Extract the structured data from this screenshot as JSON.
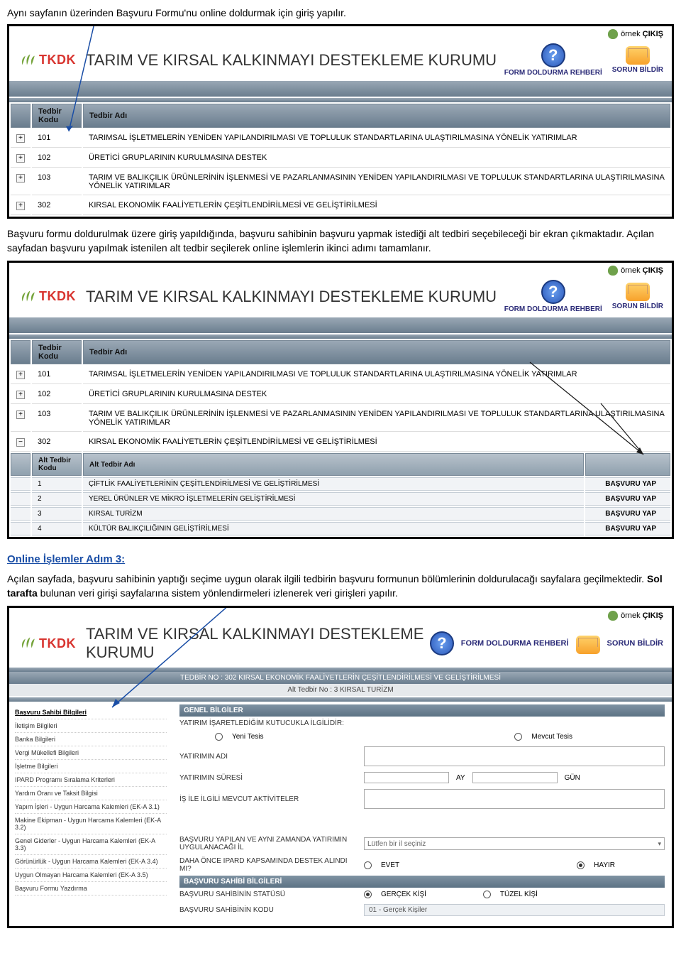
{
  "doc": {
    "intro": "Aynı sayfanın üzerinden Başvuru Formu'nu online doldurmak için giriş yapılır.",
    "mid1": "Başvuru formu doldurulmak üzere giriş yapıldığında, başvuru sahibinin başvuru yapmak istediği alt tedbiri seçebileceği bir ekran çıkmaktadır. Açılan sayfadan başvuru yapılmak istenilen alt tedbir seçilerek online işlemlerin ikinci adımı tamamlanır.",
    "step3_title": "Online İşlemler Adım 3:",
    "step3_body_a": "Açılan sayfada, başvuru sahibinin yaptığı seçime uygun olarak ilgili tedbirin başvuru formunun bölümlerinin doldurulacağı sayfalara geçilmektedir. ",
    "step3_body_b_bold": "Sol tarafta",
    "step3_body_c": " bulunan veri girişi sayfalarına sistem yönlendirmeleri izlenerek veri girişleri yapılır."
  },
  "shared": {
    "top_user": "örnek",
    "top_exit": "ÇIKIŞ",
    "logo_text": "TKDK",
    "page_title": "TARIM VE KIRSAL KALKINMAYI DESTEKLEME KURUMU",
    "form_rehberi": "FORM DOLDURMA REHBERİ",
    "sorun_bildir": "SORUN BİLDİR",
    "th_kodu": "Tedbir Kodu",
    "th_adi": "Tedbir Adı",
    "th_alt_kodu": "Alt Tedbir Kodu",
    "th_alt_adi": "Alt Tedbir Adı",
    "basvuru_yap": "BAŞVURU YAP"
  },
  "tedbir_rows": [
    {
      "code": "101",
      "name": "TARIMSAL İŞLETMELERİN YENİDEN YAPILANDIRILMASI VE TOPLULUK STANDARTLARINA ULAŞTIRILMASINA YÖNELİK YATIRIMLAR"
    },
    {
      "code": "102",
      "name": "ÜRETİCİ GRUPLARININ KURULMASINA DESTEK"
    },
    {
      "code": "103",
      "name": "TARIM VE BALIKÇILIK ÜRÜNLERİNİN İŞLENMESİ VE PAZARLANMASININ YENİDEN YAPILANDIRILMASI VE TOPLULUK STANDARTLARINA ULAŞTIRILMASINA YÖNELİK YATIRIMLAR"
    },
    {
      "code": "302",
      "name": "KIRSAL EKONOMİK FAALİYETLERİN ÇEŞİTLENDİRİLMESİ VE GELİŞTİRİLMESİ"
    }
  ],
  "alt_tedbir_rows": [
    {
      "code": "1",
      "name": "ÇİFTLİK FAALİYETLERİNİN ÇEŞİTLENDİRİLMESİ VE GELİŞTİRİLMESİ"
    },
    {
      "code": "2",
      "name": "YEREL ÜRÜNLER VE MİKRO İŞLETMELERİN GELİŞTİRİLMESİ"
    },
    {
      "code": "3",
      "name": "KIRSAL TURİZM"
    },
    {
      "code": "4",
      "name": "KÜLTÜR BALIKÇILIĞININ GELİŞTİRİLMESİ"
    }
  ],
  "screen3": {
    "title_bar": "TEDBİR NO : 302 KIRSAL EKONOMİK FAALİYETLERİN ÇEŞİTLENDİRİLMESİ VE GELİŞTİRİLMESİ",
    "sub_bar": "Alt Tedbir No : 3 KIRSAL TURİZM",
    "section_genel": "GENEL BİLGİLER",
    "section_sahip": "BAŞVURU SAHİBİ BİLGİLERİ",
    "left_menu": [
      "Başvuru Sahibi Bilgileri",
      "İletişim Bilgileri",
      "Banka Bilgileri",
      "Vergi Mükellefi Bilgileri",
      "İşletme Bilgileri",
      "IPARD Programı Sıralama Kriterleri",
      "Yardım Oranı ve Taksit Bilgisi",
      "Yapım İşleri - Uygun Harcama Kalemleri (EK-A 3.1)",
      "Makine Ekipman - Uygun Harcama Kalemleri (EK-A 3.2)",
      "Genel Giderler - Uygun Harcama Kalemleri (EK-A 3.3)",
      "Görünürlük - Uygun Harcama Kalemleri (EK-A 3.4)",
      "Uygun Olmayan Harcama Kalemleri (EK-A 3.5)",
      "Başvuru Formu Yazdırma"
    ],
    "lbl_yatirim_ilgili": "YATIRIM İŞARETLEDİĞİM KUTUCUKLA İLGİLİDİR:",
    "opt_yeni": "Yeni Tesis",
    "opt_mevcut": "Mevcut Tesis",
    "lbl_yatirim_adi": "YATIRIMIN ADI",
    "lbl_yatirim_suresi": "YATIRIMIN SÜRESİ",
    "unit_ay": "AY",
    "unit_gun": "GÜN",
    "lbl_mevcut_akt": "İŞ İLE İLGİLİ MEVCUT AKTİVİTELER",
    "lbl_il": "BAŞVURU YAPILAN VE AYNI ZAMANDA YATIRIMIN UYGULANACAĞI İL",
    "sel_il_ph": "Lütfen bir il seçiniz",
    "lbl_ipard": "DAHA ÖNCE IPARD KAPSAMINDA DESTEK ALINDI MI?",
    "opt_evet": "EVET",
    "opt_hayir": "HAYIR",
    "lbl_status": "BAŞVURU SAHİBİNİN STATÜSÜ",
    "opt_gercek": "GERÇEK KİŞİ",
    "opt_tuzel": "TÜZEL KİŞİ",
    "lbl_kodu": "BAŞVURU SAHİBİNİN KODU",
    "val_kodu": "01 - Gerçek Kişiler"
  }
}
